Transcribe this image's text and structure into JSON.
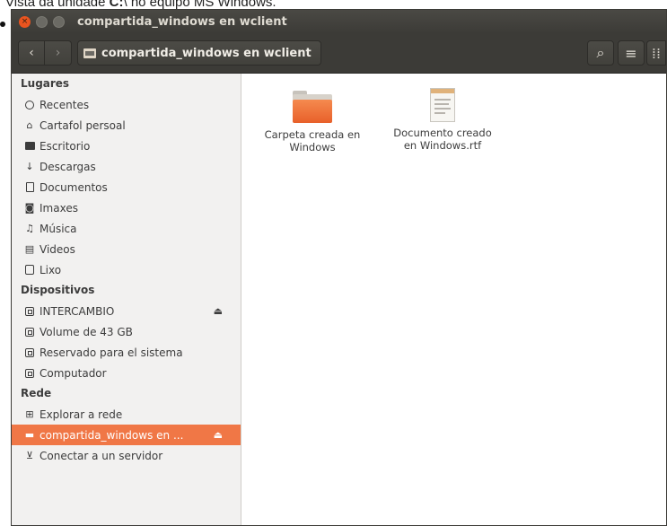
{
  "caption": {
    "pre": "Vista da unidade ",
    "bold": "C:",
    "post": "\\ no equipo MS Windows."
  },
  "window": {
    "title": "compartida_windows en wclient"
  },
  "toolbar": {
    "back_glyph": "‹",
    "forward_glyph": "›",
    "path_label": "compartida_windows en wclient",
    "search_glyph": "⌕",
    "list_glyph": "≡",
    "grid_glyph": "⁞⁞"
  },
  "sidebar": {
    "places_heading": "Lugares",
    "places": [
      {
        "label": "Recentes",
        "icon": "clock-icon"
      },
      {
        "label": "Cartafol persoal",
        "icon": "home-icon"
      },
      {
        "label": "Escritorio",
        "icon": "desktop-icon"
      },
      {
        "label": "Descargas",
        "icon": "download-icon"
      },
      {
        "label": "Documentos",
        "icon": "document-icon"
      },
      {
        "label": "Imaxes",
        "icon": "camera-icon"
      },
      {
        "label": "Música",
        "icon": "music-icon"
      },
      {
        "label": "Videos",
        "icon": "film-icon"
      },
      {
        "label": "Lixo",
        "icon": "trash-icon"
      }
    ],
    "devices_heading": "Dispositivos",
    "devices": [
      {
        "label": "INTERCAMBIO",
        "icon": "drive-icon",
        "eject": "⏏"
      },
      {
        "label": "Volume de 43 GB",
        "icon": "drive-icon"
      },
      {
        "label": "Reservado para el sistema",
        "icon": "drive-icon"
      },
      {
        "label": "Computador",
        "icon": "drive-icon"
      }
    ],
    "network_heading": "Rede",
    "network": [
      {
        "label": "Explorar a rede",
        "icon": "network-icon"
      },
      {
        "label": "compartida_windows en ...",
        "icon": "share-icon",
        "eject": "⏏",
        "selected": true
      },
      {
        "label": "Conectar a un servidor",
        "icon": "connect-icon"
      }
    ]
  },
  "files": [
    {
      "name_line1": "Carpeta creada en",
      "name_line2": "Windows",
      "icon": "folder-icon"
    },
    {
      "name_line1": "Documento creado",
      "name_line2": "en Windows.rtf",
      "icon": "document-icon"
    }
  ],
  "colors": {
    "accent": "#f07746",
    "titlebar": "#3c3b37",
    "sidebar_bg": "#f2f1f0",
    "close_button": "#e9541f"
  }
}
